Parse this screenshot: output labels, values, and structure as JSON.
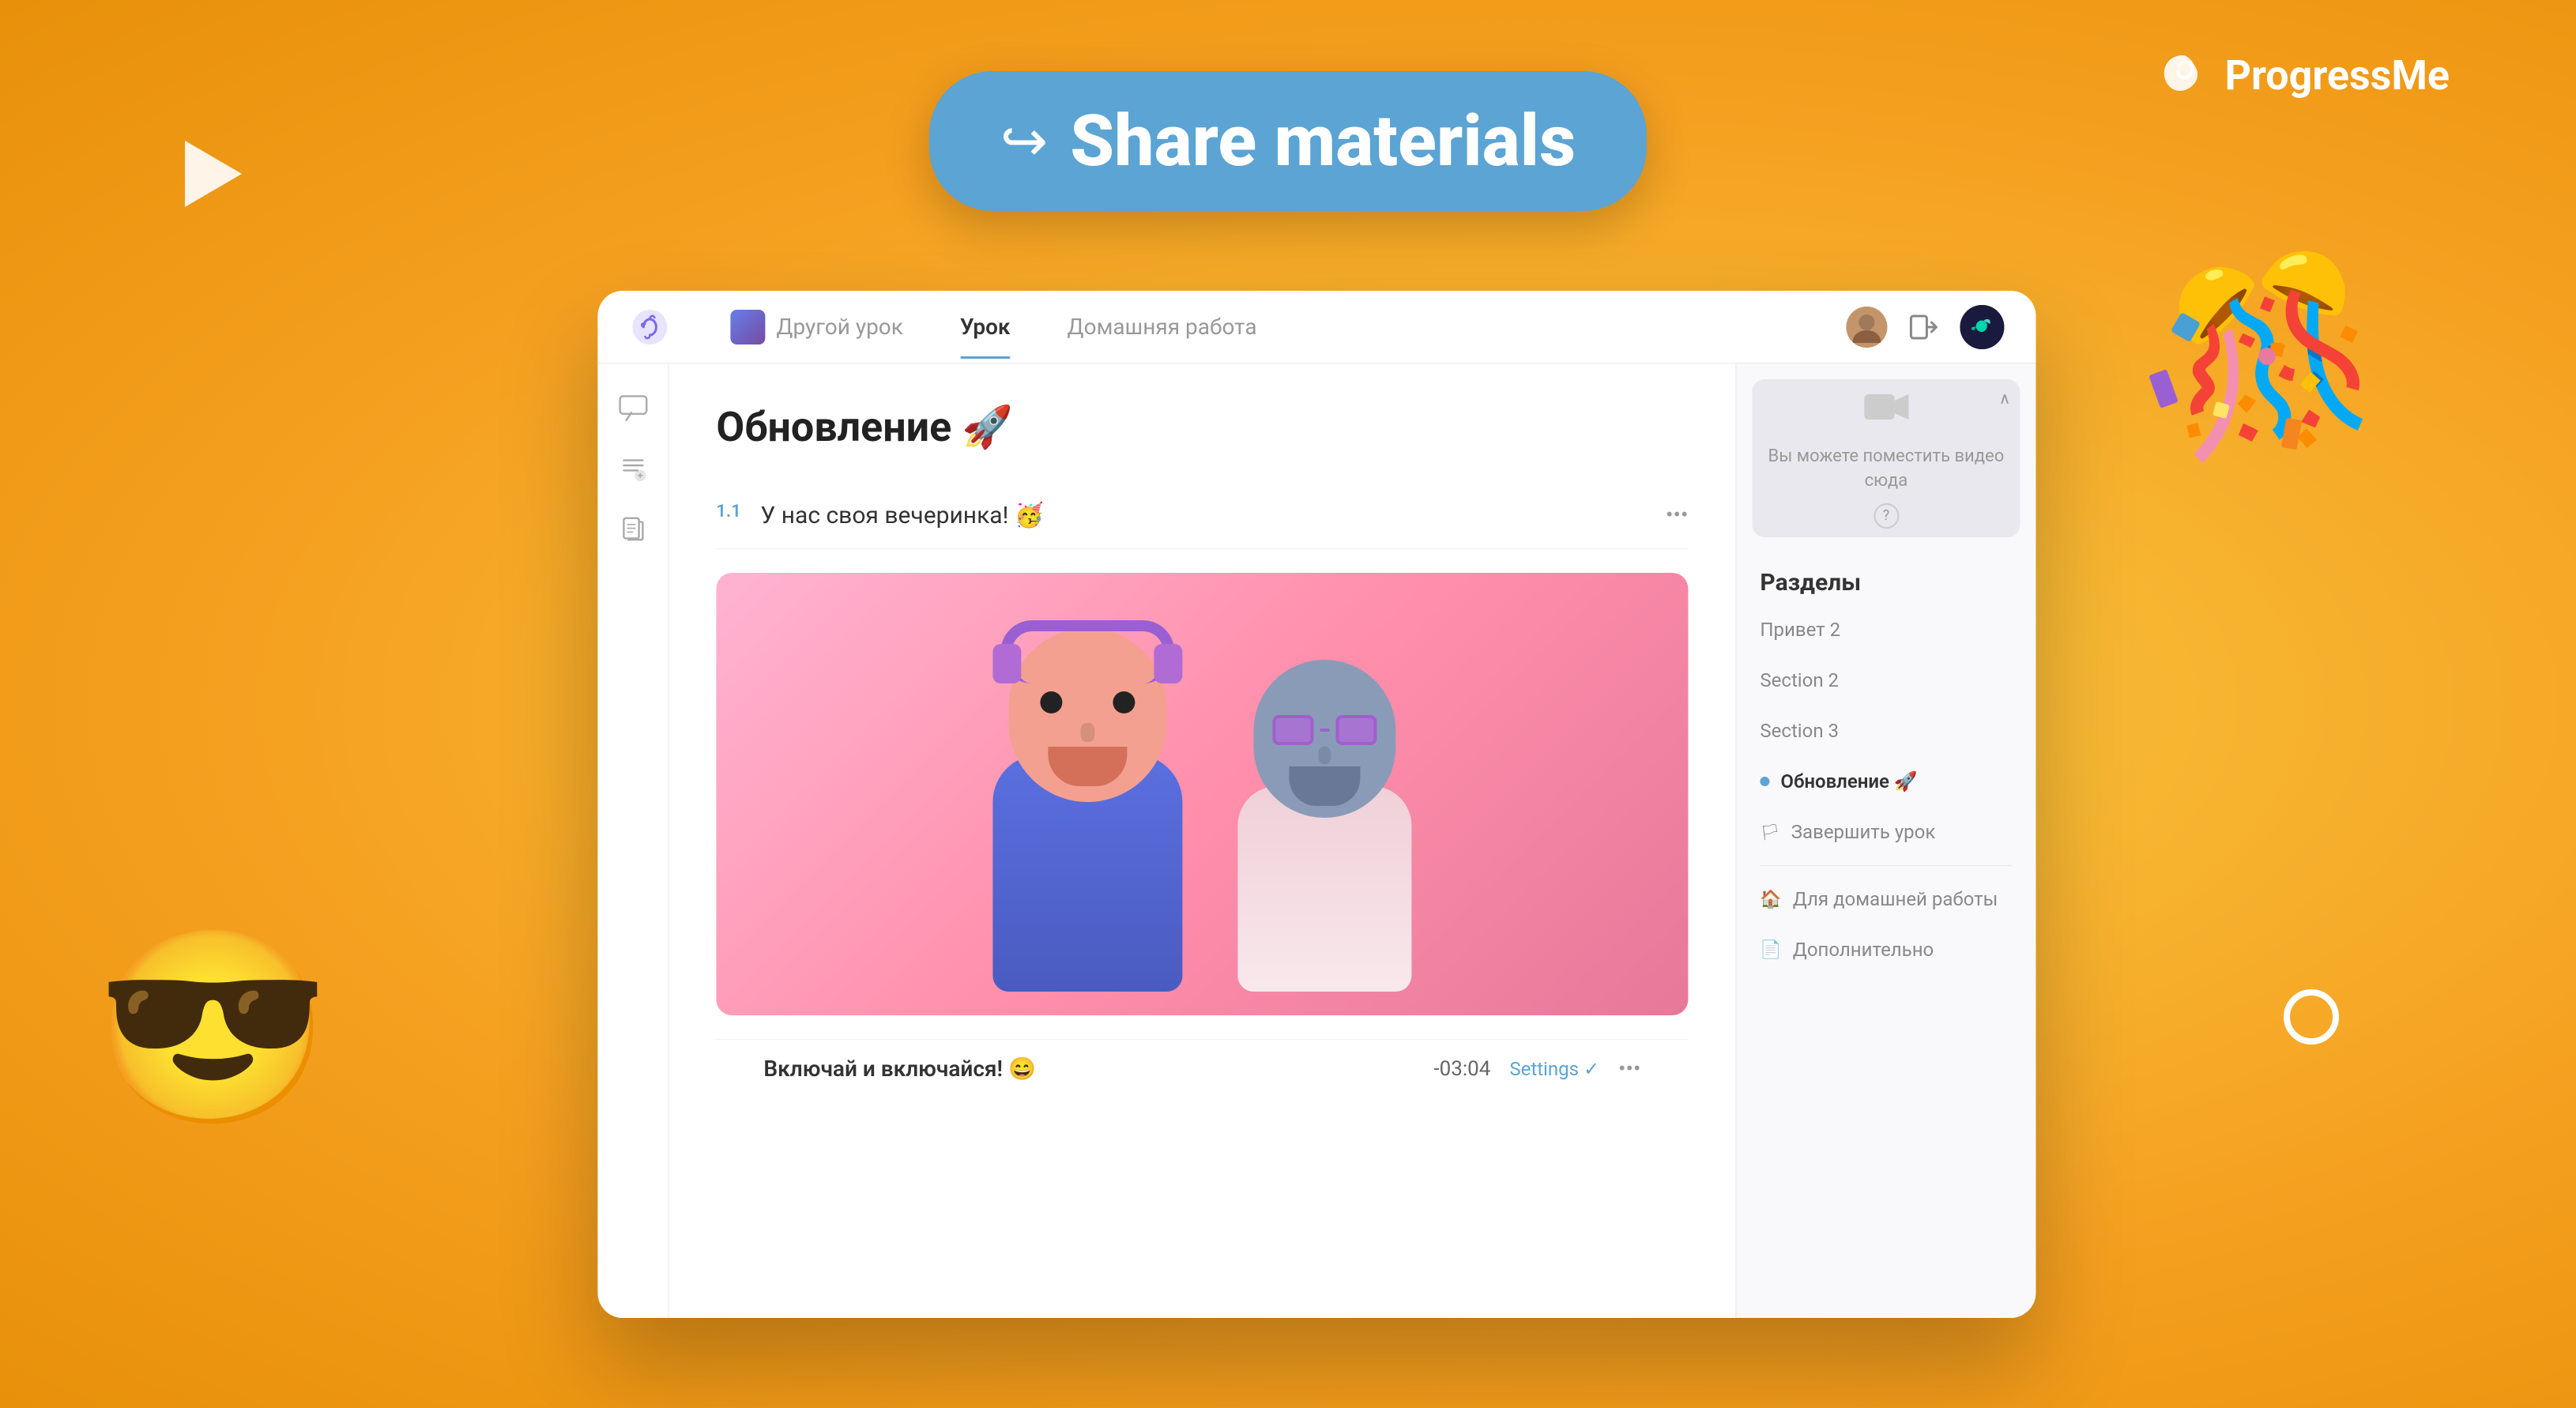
{
  "background": {
    "color": "#F5A623"
  },
  "logo": {
    "text": "ProgressMe",
    "icon_name": "progressme-logo"
  },
  "share_button": {
    "label": "Share materials",
    "icon_name": "share-arrow-icon"
  },
  "nav": {
    "tabs": [
      {
        "id": "other_lesson",
        "label": "Другой урок",
        "active": false,
        "has_img": true
      },
      {
        "id": "lesson",
        "label": "Урок",
        "active": true,
        "has_img": false
      },
      {
        "id": "homework",
        "label": "Домашняя работа",
        "active": false,
        "has_img": false
      }
    ]
  },
  "lesson": {
    "title": "Обновление 🚀",
    "item_number": "1.1",
    "item_text": "У нас своя вечеринка! 🥳",
    "media_title": "Включай и включайся! 😄",
    "media_time": "-03:04",
    "media_settings_label": "Settings ✓"
  },
  "video_placeholder": {
    "text": "Вы можете поместить видео сюда"
  },
  "sections": {
    "title": "Разделы",
    "items": [
      {
        "id": "privet2",
        "label": "Привет 2",
        "active": false,
        "type": "plain"
      },
      {
        "id": "section2",
        "label": "Section 2",
        "active": false,
        "type": "plain"
      },
      {
        "id": "section3",
        "label": "Section 3",
        "active": false,
        "type": "plain"
      },
      {
        "id": "update",
        "label": "Обновление 🚀",
        "active": true,
        "type": "dot"
      },
      {
        "id": "finish",
        "label": "Завершить урок",
        "active": false,
        "type": "flag"
      }
    ],
    "homework_label": "Для домашней работы",
    "extra_label": "Дополнительно"
  },
  "sidebar_icons": [
    {
      "id": "chat",
      "icon": "💬"
    },
    {
      "id": "text",
      "icon": "🔤"
    },
    {
      "id": "doc",
      "icon": "📄"
    }
  ],
  "decorations": {
    "cool_emoji": "😎",
    "party_emoji": "🎉"
  }
}
